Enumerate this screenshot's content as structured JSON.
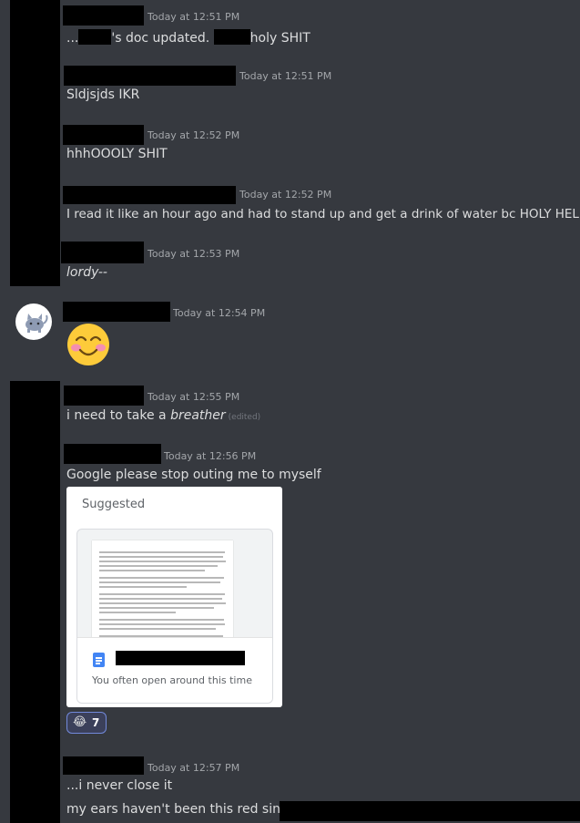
{
  "messages": [
    {
      "timestamp": "Today at 12:51 PM",
      "parts": [
        "...",
        "'s doc updated.",
        "holy SHIT"
      ]
    },
    {
      "timestamp": "Today at 12:51 PM",
      "text": "Sldjsjds IKR"
    },
    {
      "timestamp": "Today at 12:52 PM",
      "text": "hhhOOOLY SHIT"
    },
    {
      "timestamp": "Today at 12:52 PM",
      "text": "I read it like an hour ago and had to stand up and get a drink of water bc HOLY HELL"
    },
    {
      "timestamp": "Today at 12:53 PM",
      "text": "lordy--"
    },
    {
      "timestamp": "Today at 12:54 PM",
      "emoji": "😊"
    },
    {
      "timestamp": "Today at 12:55 PM",
      "text_before": "i need to take a ",
      "text_italic": "breather",
      "edited": "(edited)"
    },
    {
      "timestamp": "Today at 12:56 PM",
      "text": "Google please stop outing me to myself"
    },
    {
      "timestamp": "Today at 12:57 PM",
      "text": "...i never close it",
      "text2": "my ears haven't been this red since"
    }
  ],
  "embed": {
    "title": "Suggested",
    "subtitle": "You often open around this time"
  },
  "reaction": {
    "emoji": "😂",
    "count": "7"
  },
  "colors": {
    "background": "#36393f",
    "text": "#dcddde",
    "timestamp": "#a3a6aa",
    "reaction_border": "#7289da"
  }
}
